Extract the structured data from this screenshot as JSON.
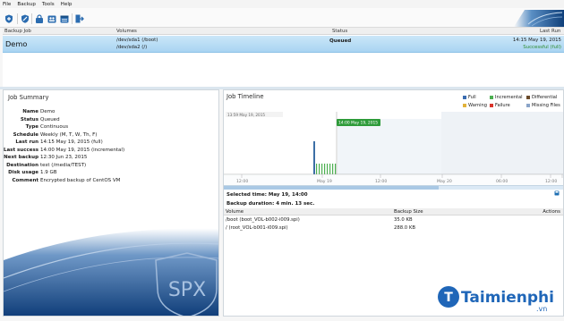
{
  "menu": [
    "File",
    "Backup",
    "Tools",
    "Help"
  ],
  "colors": {
    "selection": "#a9d4f2",
    "accent": "#1e6fb3",
    "success": "#2e8b2e",
    "timeline_bar": "#3c6fa6",
    "incremental": "#4caf50",
    "marker": "#2e9b3a"
  },
  "toolbar": {
    "icons": [
      "shield-add-icon",
      "shield-edit-icon",
      "lock-icon",
      "user-group-icon",
      "calendar-icon",
      "logout-icon"
    ]
  },
  "jobs": {
    "columns": [
      "Backup Job",
      "Volumes",
      "Status",
      "Last Run"
    ],
    "rows": [
      {
        "name": "Demo",
        "volumes": [
          "/dev/sda1 (/boot)",
          "/dev/sda2 (/)"
        ],
        "status": "Queued",
        "last_run": "14:15 May 19, 2015",
        "last_run_result": "Successful (full)"
      }
    ]
  },
  "summary": {
    "title": "Job Summary",
    "fields": [
      {
        "label": "Name",
        "value": "Demo"
      },
      {
        "label": "Status",
        "value": "Queued"
      },
      {
        "label": "Type",
        "value": "Continuous"
      },
      {
        "label": "Schedule",
        "value": "Weekly (M, T, W, Th, F)"
      },
      {
        "label": "Last run",
        "value": "14:15 May 19, 2015 (full)"
      },
      {
        "label": "Last success",
        "value": "14:00 May 19, 2015 (incremental)"
      },
      {
        "label": "Next backup",
        "value": "12:30 Jun 23, 2015"
      },
      {
        "label": "Destination",
        "value": "test (/media/TEST)"
      },
      {
        "label": "Disk usage",
        "value": "1.9 GB"
      },
      {
        "label": "Comment",
        "value": "Encrypted backup of CentOS VM"
      }
    ],
    "logo_text": "SPX"
  },
  "timeline": {
    "title": "Job Timeline",
    "legend": [
      "Full",
      "Incremental",
      "Differential",
      "Warning",
      "Failure",
      "Missing Files"
    ],
    "legend_colors": [
      "#3b6cb0",
      "#4caf50",
      "#6b4b2b",
      "#e1b23a",
      "#d9342b",
      "#8aa4c8"
    ],
    "start_label": "13:59 May 19, 2015",
    "marker_label": "14:00 May 19, 2015",
    "axis_ticks": [
      "12:00",
      "May 19",
      "12:00",
      "May 20",
      "06:00",
      "12:00",
      "06:00"
    ],
    "selected_time": "Selected time: May 19, 14:00",
    "duration": "Backup duration: 4 min. 13 sec.",
    "volume_columns": [
      "Volume",
      "Backup Size",
      "Actions"
    ],
    "volumes": [
      {
        "volume": "/boot (boot_VOL-b002-i009.spi)",
        "size": "35.0 KB"
      },
      {
        "volume": "/ (root_VOL-b001-i009.spi)",
        "size": "288.0 KB"
      }
    ]
  },
  "watermark": {
    "brand": "Taimienphi",
    "suffix": ".vn"
  }
}
